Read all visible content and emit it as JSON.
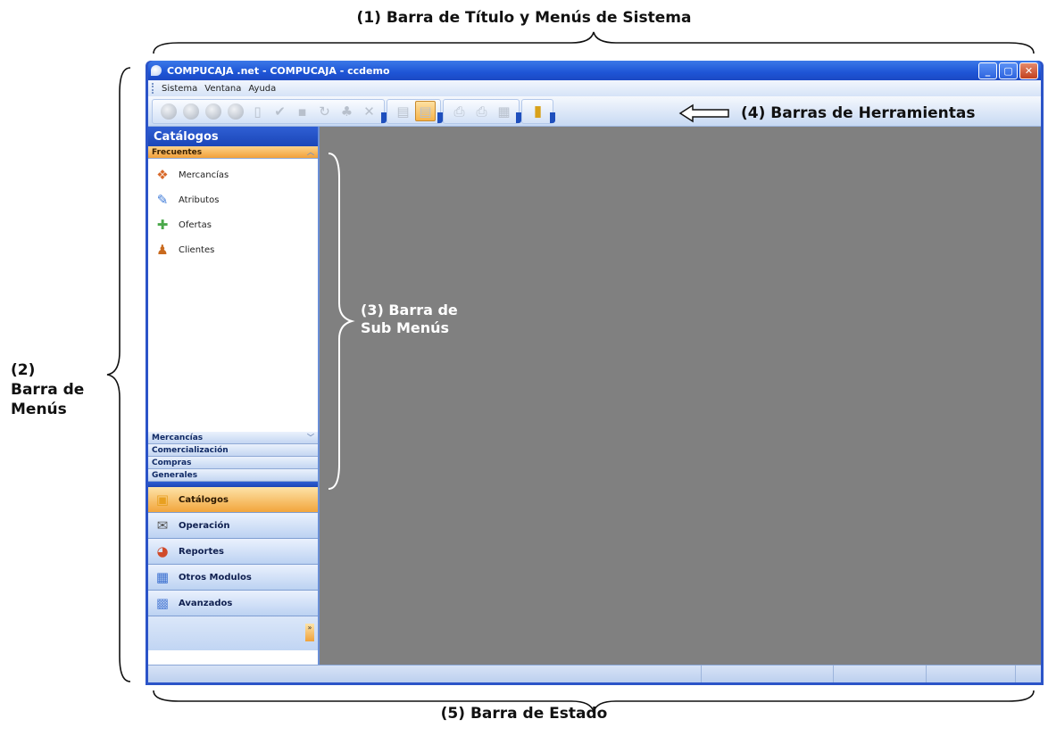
{
  "annotations": {
    "title_system": "(1) Barra de Título y Menús de Sistema",
    "menu_bar_1": "(2)",
    "menu_bar_2": "Barra de",
    "menu_bar_3": "Menús",
    "sub_menu_1": "(3) Barra de",
    "sub_menu_2": "Sub Menús",
    "toolbars": "(4) Barras de Herramientas",
    "status_bar": "(5) Barra de Estado"
  },
  "window": {
    "title": "COMPUCAJA .net - COMPUCAJA - ccdemo"
  },
  "menubar": {
    "items": [
      "Sistema",
      "Ventana",
      "Ayuda"
    ]
  },
  "sidebar": {
    "header": "Catálogos",
    "open_group": "Frecuentes",
    "items": [
      {
        "label": "Mercancías",
        "icon": "merchandise-icon"
      },
      {
        "label": "Atributos",
        "icon": "attributes-icon"
      },
      {
        "label": "Ofertas",
        "icon": "offers-icon"
      },
      {
        "label": "Clientes",
        "icon": "clients-icon"
      }
    ],
    "collapsed_groups": [
      "Mercancías",
      "Comercialización",
      "Compras",
      "Generales"
    ],
    "nav_buttons": [
      {
        "label": "Catálogos",
        "icon": "catalogs-icon",
        "selected": true
      },
      {
        "label": "Operación",
        "icon": "operation-icon",
        "selected": false
      },
      {
        "label": "Reportes",
        "icon": "reports-icon",
        "selected": false
      },
      {
        "label": "Otros Modulos",
        "icon": "other-modules-icon",
        "selected": false
      },
      {
        "label": "Avanzados",
        "icon": "advanced-icon",
        "selected": false
      }
    ]
  },
  "colors": {
    "titlebar": "#1e55d6",
    "workspace": "#808080",
    "selected": "#f2a53c"
  }
}
